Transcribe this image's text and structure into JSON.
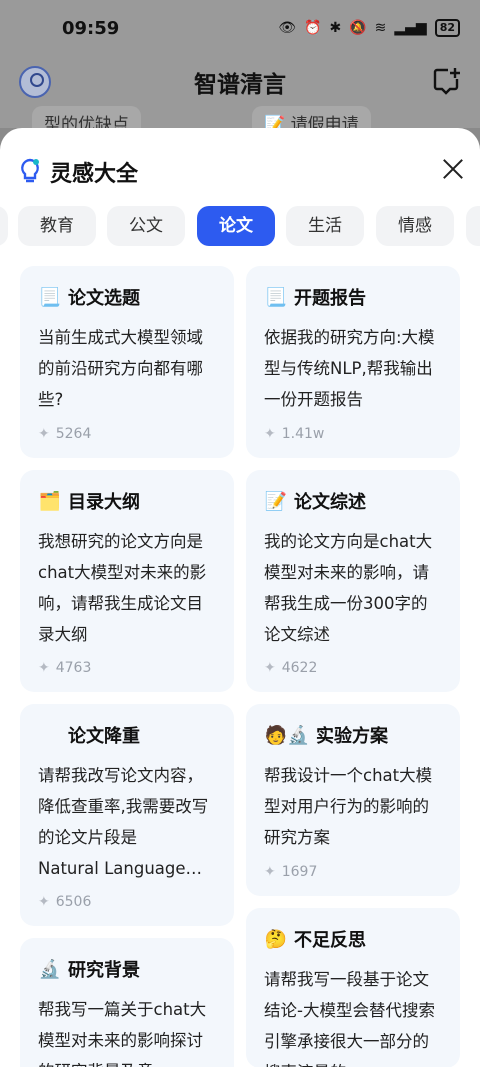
{
  "status": {
    "time": "09:59",
    "battery": "82",
    "icons": [
      "eye-icon",
      "alarm-icon",
      "bluetooth-icon",
      "mute-icon",
      "wifi-icon",
      "signal-icon",
      "battery-icon"
    ]
  },
  "app": {
    "title": "智谱清言",
    "behind_left": "型的优缺点",
    "behind_right": "📝 请假申请"
  },
  "sheet": {
    "title": "灵感大全",
    "tabs": [
      "教育",
      "公文",
      "论文",
      "生活",
      "情感"
    ],
    "active_tab": "论文"
  },
  "cards": [
    {
      "emoji": "📃",
      "title": "论文选题",
      "desc": "当前生成式大模型领域的前沿研究方向都有哪些?",
      "count": "5264"
    },
    {
      "emoji": "📃",
      "title": "开题报告",
      "desc": "依据我的研究方向:大模型与传统NLP,帮我输出一份开题报告",
      "count": "1.41w"
    },
    {
      "emoji": "🗂️",
      "title": "目录大纲",
      "desc": "我想研究的论文方向是chat大模型对未来的影响，请帮我生成论文目录大纲",
      "count": "4763"
    },
    {
      "emoji": "📝",
      "title": "论文综述",
      "desc": "我的论文方向是chat大模型对未来的影响，请帮我生成一份300字的论文综述",
      "count": "4622"
    },
    {
      "emoji": "",
      "title": "论文降重",
      "desc": "请帮我改写论文内容，降低查重率,我需要改写的论文片段是",
      "desc_last": "Natural Language…",
      "count": "6506"
    },
    {
      "emoji": "🧑🔬",
      "title": "实验方案",
      "desc": "帮我设计一个chat大模型对用户行为的影响的研究方案",
      "count": "1697"
    },
    {
      "emoji": "🔬",
      "title": "研究背景",
      "desc": "帮我写一篇关于chat大模型对未来的影响探讨的研究背景及意",
      "count": ""
    },
    {
      "emoji": "🤔",
      "title": "不足反思",
      "desc": "请帮我写一段基于论文结论-大模型会替代搜索引擎承接很大一部分的搜索流量的",
      "count": ""
    }
  ],
  "colors": {
    "accent": "#2d5bf0",
    "card_bg": "#f3f7fc",
    "tab_bg": "#f2f3f5"
  }
}
